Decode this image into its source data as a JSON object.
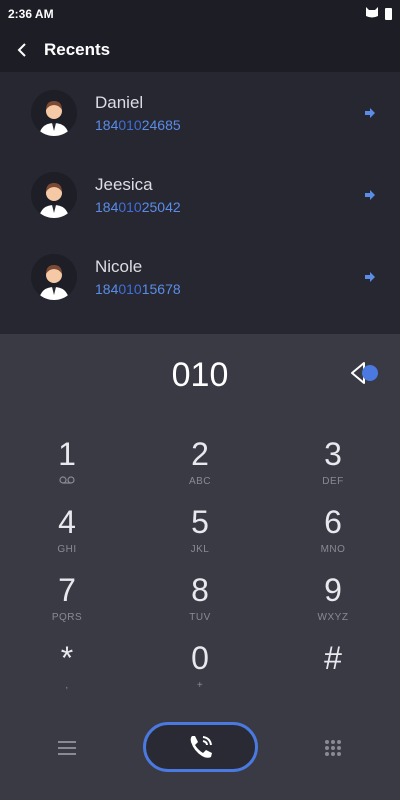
{
  "status_bar": {
    "time": "2:36 AM"
  },
  "header": {
    "title": "Recents"
  },
  "recents": [
    {
      "name": "Daniel",
      "number_prefix": "184",
      "number_match": "010",
      "number_suffix": "24685"
    },
    {
      "name": "Jeesica",
      "number_prefix": "184",
      "number_match": "010",
      "number_suffix": "25042"
    },
    {
      "name": "Nicole",
      "number_prefix": "184",
      "number_match": "010",
      "number_suffix": "15678"
    }
  ],
  "dial": {
    "value": "010"
  },
  "keypad": {
    "keys": [
      {
        "digit": "1",
        "sub": "QQ"
      },
      {
        "digit": "2",
        "sub": "ABC"
      },
      {
        "digit": "3",
        "sub": "DEF"
      },
      {
        "digit": "4",
        "sub": "GHI"
      },
      {
        "digit": "5",
        "sub": "JKL"
      },
      {
        "digit": "6",
        "sub": "MNO"
      },
      {
        "digit": "7",
        "sub": "PQRS"
      },
      {
        "digit": "8",
        "sub": "TUV"
      },
      {
        "digit": "9",
        "sub": "WXYZ"
      },
      {
        "digit": "*",
        "sub": ","
      },
      {
        "digit": "0",
        "sub": "+"
      },
      {
        "digit": "#",
        "sub": ""
      }
    ]
  },
  "colors": {
    "accent": "#4a79e0",
    "number_link": "#5a8de8",
    "background": "#3a3a45",
    "recents_bg": "#272731"
  },
  "icons": [
    "back-chevron-icon",
    "battery-icon",
    "cat-icon",
    "backspace-icon",
    "menu-icon",
    "phone-call-icon",
    "dialpad-icon",
    "call-arrow-icon"
  ]
}
